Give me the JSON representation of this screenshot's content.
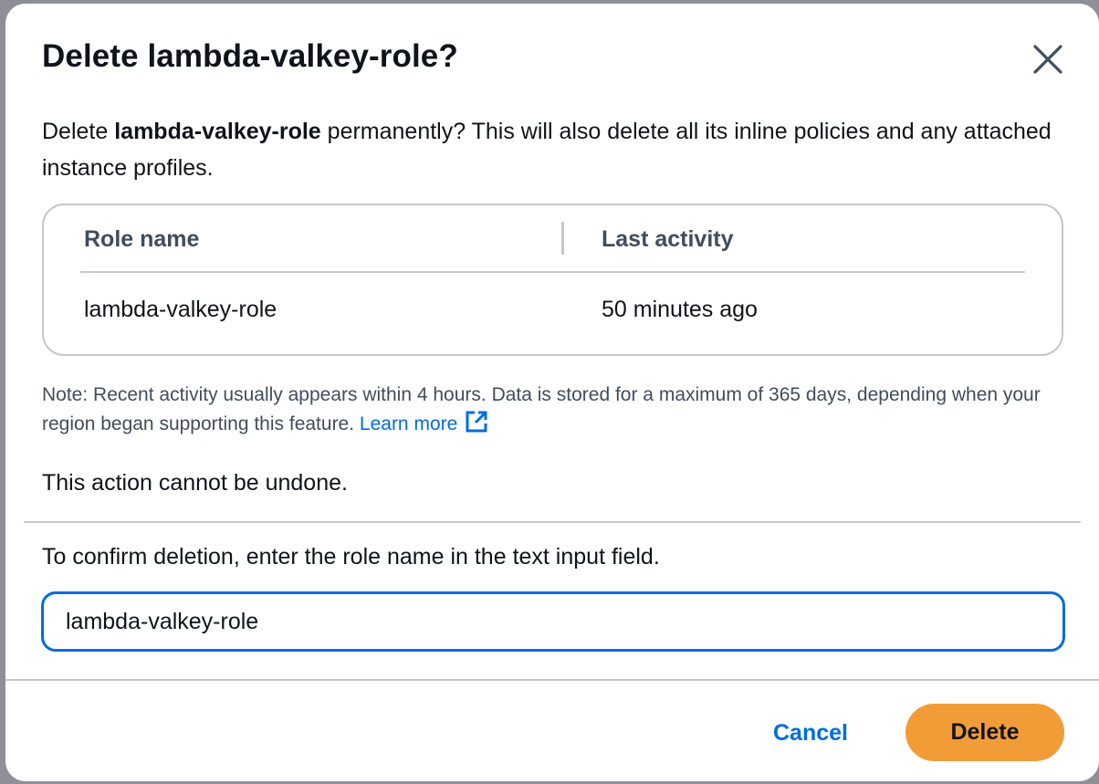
{
  "dialog": {
    "title": "Delete lambda-valkey-role?",
    "description_prefix": "Delete ",
    "role_name_bold": "lambda-valkey-role",
    "description_suffix": " permanently? This will also delete all its inline policies and any attached instance profiles."
  },
  "table": {
    "columns": [
      "Role name",
      "Last activity"
    ],
    "rows": [
      {
        "role_name": "lambda-valkey-role",
        "last_activity": "50 minutes ago"
      }
    ]
  },
  "note": {
    "text": "Note: Recent activity usually appears within 4 hours. Data is stored for a maximum of 365 days, depending when your region began supporting this feature. ",
    "link_label": "Learn more",
    "link_icon": "external-link-icon"
  },
  "warning": "This action cannot be undone.",
  "confirm": {
    "label": "To confirm deletion, enter the role name in the text input field.",
    "value": "lambda-valkey-role"
  },
  "footer": {
    "cancel_label": "Cancel",
    "delete_label": "Delete"
  },
  "colors": {
    "primary_link": "#006ce0",
    "delete_button": "#f29c38",
    "border": "#c6c6cd",
    "text": "#0f141a"
  }
}
